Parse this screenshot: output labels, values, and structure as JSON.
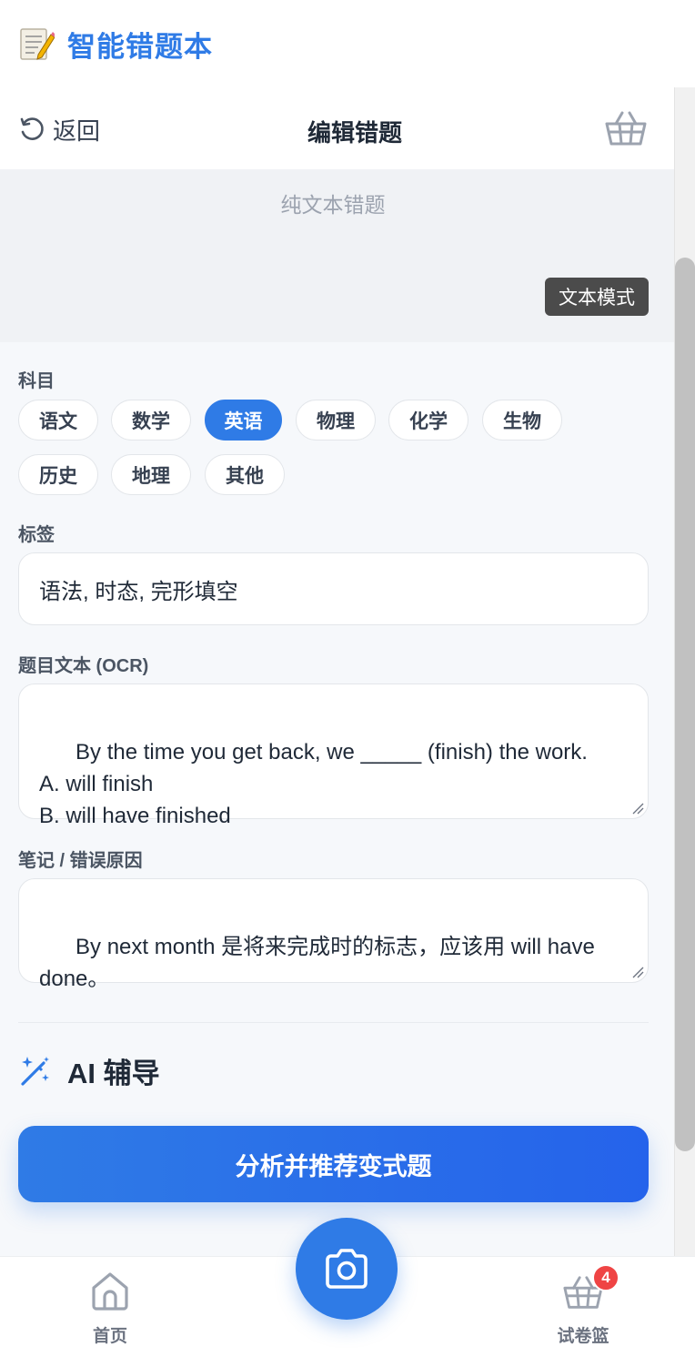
{
  "app": {
    "title": "智能错题本"
  },
  "header": {
    "back_label": "返回",
    "title": "编辑错题"
  },
  "preview": {
    "text": "纯文本错题",
    "mode_badge": "文本模式"
  },
  "form": {
    "subject_label": "科目",
    "subjects": [
      "语文",
      "数学",
      "英语",
      "物理",
      "化学",
      "生物",
      "历史",
      "地理",
      "其他"
    ],
    "selected_subject": "英语",
    "tags_label": "标签",
    "tags_value": "语法, 时态, 完形填空",
    "question_label": "题目文本 (OCR)",
    "question_value": "By the time you get back, we _____ (finish) the work.\nA. will finish\nB. will have finished",
    "notes_label": "笔记 / 错误原因",
    "notes_value": "By next month 是将来完成时的标志，应该用 will have done。"
  },
  "ai": {
    "title": "AI 辅导",
    "analyze_button": "分析并推荐变式题"
  },
  "bottom_nav": {
    "home_label": "首页",
    "basket_label": "试卷篮",
    "basket_count": "4"
  },
  "colors": {
    "accent": "#2f7be6",
    "badge": "#ef4444"
  },
  "icons": {
    "logo": "memo-pencil-icon",
    "back": "undo-arrow-icon",
    "basket": "basket-icon",
    "ai": "magic-wand-icon",
    "camera": "camera-icon",
    "home": "home-icon"
  }
}
